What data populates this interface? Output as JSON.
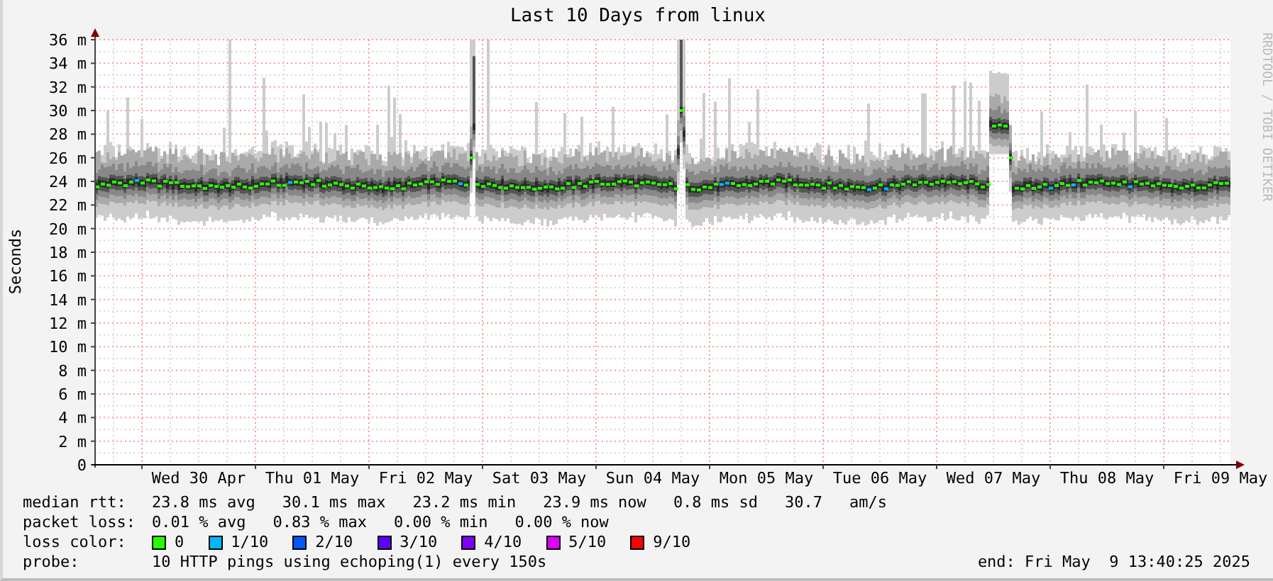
{
  "graph": {
    "title": "Last 10 Days from linux",
    "y_axis_label": "Seconds",
    "credit": "RRDTOOL / TOBI OETIKER",
    "y_ticks": [
      "36 m",
      "34 m",
      "32 m",
      "30 m",
      "28 m",
      "26 m",
      "24 m",
      "22 m",
      "20 m",
      "18 m",
      "16 m",
      "14 m",
      "12 m",
      "10 m",
      "8 m",
      "6 m",
      "4 m",
      "2 m",
      "0"
    ],
    "x_labels": [
      "Wed 30 Apr",
      "Thu 01 May",
      "Fri 02 May",
      "Sat 03 May",
      "Sun 04 May",
      "Mon 05 May",
      "Tue 06 May",
      "Wed 07 May",
      "Thu 08 May",
      "Fri 09 May"
    ]
  },
  "legend": {
    "median_rtt": {
      "label": "median rtt:",
      "values": [
        "23.8 ms avg",
        "30.1 ms max",
        "23.2 ms min",
        "23.9 ms now",
        "0.8 ms sd",
        "30.7",
        "am/s"
      ]
    },
    "packet_loss": {
      "label": "packet loss:",
      "values": [
        "0.01 % avg",
        "0.83 % max",
        "0.00 % min",
        "0.00 % now"
      ]
    },
    "loss_color": {
      "label": "loss color:",
      "items": [
        {
          "label": "0",
          "color": "#26ff00"
        },
        {
          "label": "1/10",
          "color": "#00b8ff"
        },
        {
          "label": "2/10",
          "color": "#0059ff"
        },
        {
          "label": "3/10",
          "color": "#5e00ff"
        },
        {
          "label": "4/10",
          "color": "#7e00ff"
        },
        {
          "label": "5/10",
          "color": "#dd00ff"
        },
        {
          "label": "9/10",
          "color": "#ff0000"
        }
      ]
    },
    "probe": {
      "label": "probe:",
      "text": "10 HTTP pings using echoping(1) every 150s"
    },
    "end": "end: Fri May  9 13:40:25 2025"
  }
}
